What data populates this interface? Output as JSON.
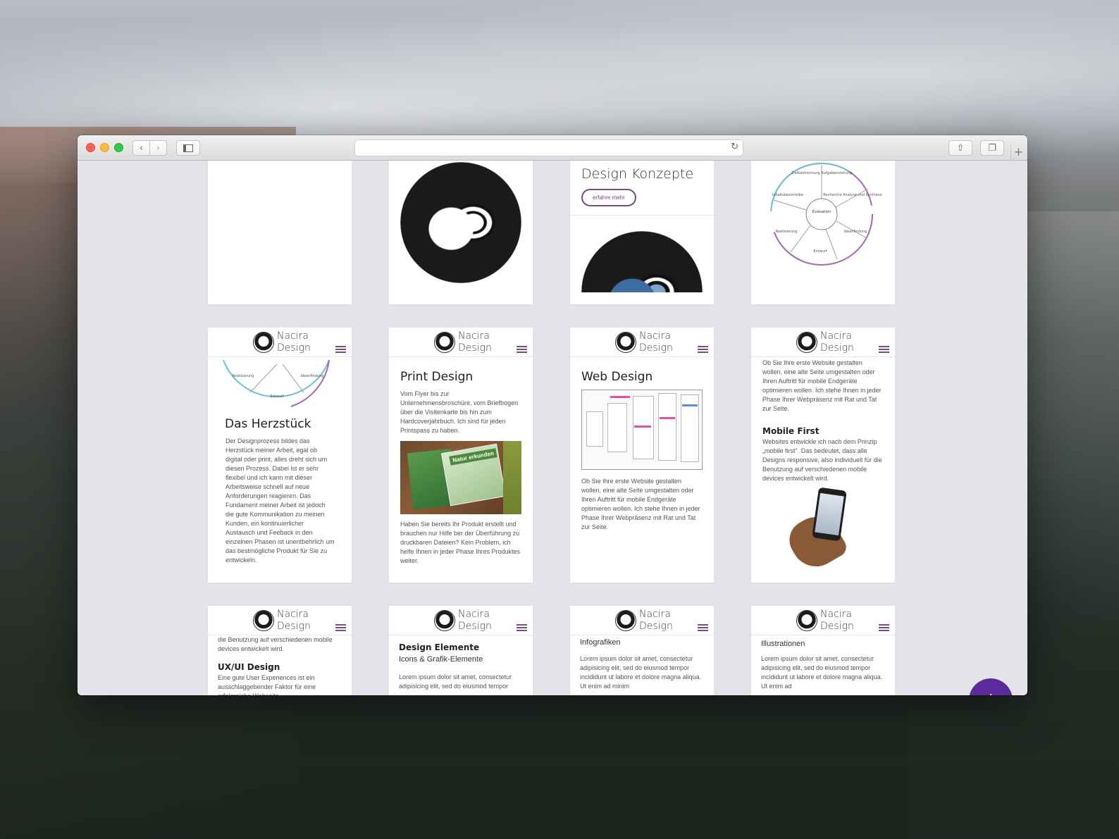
{
  "browser": {
    "back_icon": "chevron-left-icon",
    "forward_icon": "chevron-right-icon",
    "reload_icon": "reload-icon",
    "share_icon": "share-icon",
    "tabs_icon": "tabs-icon",
    "new_tab_icon": "plus-icon"
  },
  "brand": {
    "line1": "Nacira",
    "line2": "Design"
  },
  "cards": {
    "design_konzepte": {
      "title": "Design Konzepte",
      "button": "erfahre mehr"
    },
    "cycle": {
      "labels": [
        "Zielbestimmung Aufgabenstellung",
        "Recherche Analyse und Synthese",
        "Ideenfindung",
        "Entwurf",
        "Realisierung",
        "Inhaltsbeschreibe",
        "Evaluation"
      ]
    },
    "herzstueck": {
      "cycle_labels": [
        "Realisierung",
        "Ideenfindung",
        "Entwurf"
      ],
      "title": "Das Herzstück",
      "text": "Der Designprozess bildes das Herzstück meiner Arbeit, egal ob digital oder print, alles dreht sich um diesen Prozess. Dabei ist er sehr flexibel und ich kann mit dieser Arbeitsweise schnell auf neue Anforderungen reagieren. Das Fundament meiner Arbeit ist jedoch die gute Kommunikation zu meinen Kunden, ein kontinuierlicher Austausch und Feeback in den einzelnen Phasen ist unentbehrlich um das bestmögliche Produkt für Sie zu entwickeln."
    },
    "print": {
      "title": "Print Design",
      "text1": "Vom Flyer bis zur Unternehmensbroschüre, vom Briefbogen über die Visitenkarte bis hin zum Hardcoverjahrbuch. Ich sind für jeden Printspass zu haben.",
      "photo_label": "Natur erkunden",
      "text2": "Haben Sie bereits Ihr Produkt erstellt und brauchen nur Hilfe ber der Überführung zu druckbaren Dateien? Kein Problem, ich helfe Ihnen in jeder Phase Ihres Produktes weiter."
    },
    "web": {
      "title": "Web Design",
      "text": "Ob Sie Ihre erste Website gestalten wollen, eine alte Seite umgestalten oder Ihren Auftritt für mobile Endgeräte optimieren wollen. Ich stehe Ihnen in jeder Phase Ihrer Webpräsenz mit Rat und Tat zur Seite."
    },
    "mobile": {
      "intro": "Ob Sie Ihre erste Website gestalten wollen, eine alte Seite umgestalten oder Ihren Auftritt für mobile Endgeräte optimieren wollen. Ich stehe Ihnen in jeder Phase Ihrer Webpräsenz mit Rat und Tat zur Seite.",
      "title": "Mobile First",
      "text": "Websites entwickle ich nach dem Prinzip „mobile first\". Das bedeutet, dass alle Designs responsive, also individuell für die Benutzung auf verschiedenen mobile devices entwickelt wird."
    },
    "uxui": {
      "intro": "die Benutzung auf verschiedenen mobile devices entwickelt wird.",
      "title": "UX/UI Design",
      "text": "Eine gute User Experiences ist ein ausschlaggebender Faktor für eine erfolgreiche Webseite..."
    },
    "elemente": {
      "title": "Design Elemente",
      "subtitle": "Icons & Grafik-Elemente",
      "text": "Lorem ipsum dolor sit amet, consectetur adipisicing elit, sed do eiusmod tempor"
    },
    "infografiken": {
      "title": "Infografiken",
      "text": "Lorem ipsum dolor sit amet, consectetur adipisicing elit, sed do eiusmod tempor incididunt ut labore et dolore magna aliqua. Ut enim ad minim"
    },
    "illustrationen": {
      "title": "Illustrationen",
      "text": "Lorem ipsum dolor sit amet, consectetur adipisicing elit, sed do eiusmod tempor incididunt ut labore et dolore magna aliqua. Ut enim ad"
    }
  },
  "fab": {
    "label": "+"
  },
  "colors": {
    "accent": "#7b4a82",
    "fab": "#5b2b9e",
    "cycle_purple": "#a766b5",
    "cycle_teal": "#6cc2cf"
  }
}
